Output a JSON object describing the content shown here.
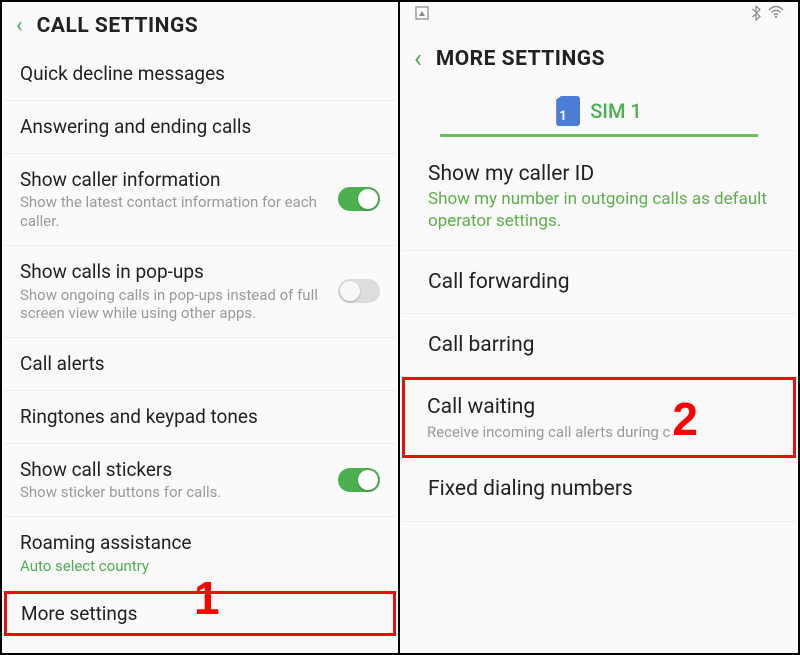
{
  "left": {
    "title": "CALL SETTINGS",
    "items": {
      "quick_decline": "Quick decline messages",
      "answering": "Answering and ending calls",
      "show_caller_info": "Show caller information",
      "show_caller_info_sub": "Show the latest contact information for each caller.",
      "popups": "Show calls in pop-ups",
      "popups_sub": "Show ongoing calls in pop-ups instead of full screen view while using other apps.",
      "call_alerts": "Call alerts",
      "ringtones": "Ringtones and keypad tones",
      "stickers": "Show call stickers",
      "stickers_sub": "Show sticker buttons for calls.",
      "roaming": "Roaming assistance",
      "roaming_sub": "Auto select country",
      "more": "More settings"
    }
  },
  "right": {
    "title": "MORE SETTINGS",
    "sim_num": "1",
    "sim_label": "SIM 1",
    "items": {
      "caller_id": "Show my caller ID",
      "caller_id_sub": "Show my number in outgoing calls as default operator settings.",
      "forwarding": "Call forwarding",
      "barring": "Call barring",
      "waiting": "Call waiting",
      "waiting_sub": "Receive incoming call alerts during c",
      "fixed": "Fixed dialing numbers"
    }
  },
  "annotations": {
    "one": "1",
    "two": "2"
  }
}
